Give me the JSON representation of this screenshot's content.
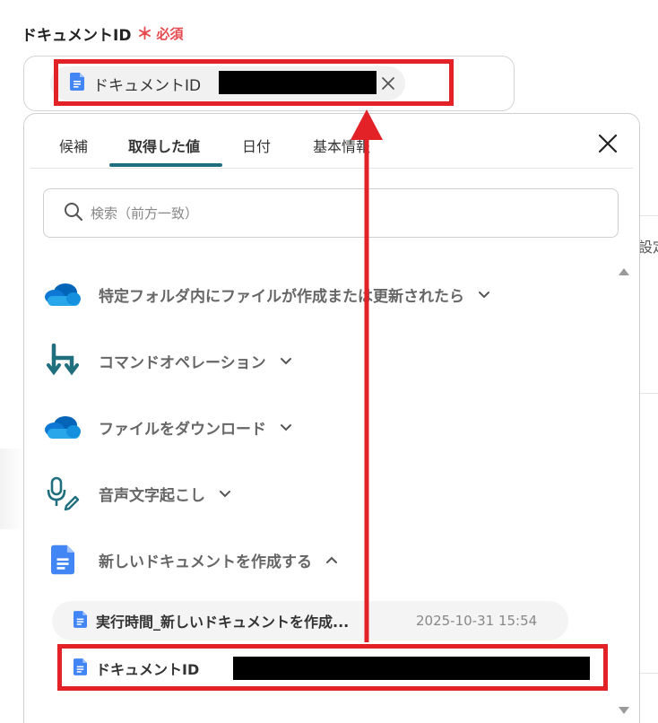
{
  "field": {
    "label": "ドキュメントID",
    "required_mark": "＊",
    "required_text": "必須",
    "chip_label": "ドキュメントID"
  },
  "tabs": [
    {
      "label": "候補",
      "active": false
    },
    {
      "label": "取得した値",
      "active": true
    },
    {
      "label": "日付",
      "active": false
    },
    {
      "label": "基本情報",
      "active": false
    }
  ],
  "search": {
    "placeholder": "検索（前方一致）",
    "value": ""
  },
  "groups": [
    {
      "label": "特定フォルダ内にファイルが作成または更新されたら",
      "icon": "onedrive-icon",
      "expanded": false
    },
    {
      "label": "コマンドオペレーション",
      "icon": "command-operation-icon",
      "expanded": false
    },
    {
      "label": "ファイルをダウンロード",
      "icon": "onedrive-icon",
      "expanded": false
    },
    {
      "label": "音声文字起こし",
      "icon": "microphone-pen-icon",
      "expanded": false
    },
    {
      "label": "新しいドキュメントを作成する",
      "icon": "google-docs-icon",
      "expanded": true
    }
  ],
  "sub_items": [
    {
      "label": "実行時間_新しいドキュメントを作成...",
      "time": "2025-10-31 15:54"
    },
    {
      "label": "ドキュメントID"
    }
  ],
  "background": {
    "setting_text": "設定"
  },
  "colors": {
    "accent": "#1f6f7e",
    "required": "#e5484d",
    "highlight": "#e32227",
    "onedrive": "#0f78d4",
    "docs": "#4285f4"
  }
}
